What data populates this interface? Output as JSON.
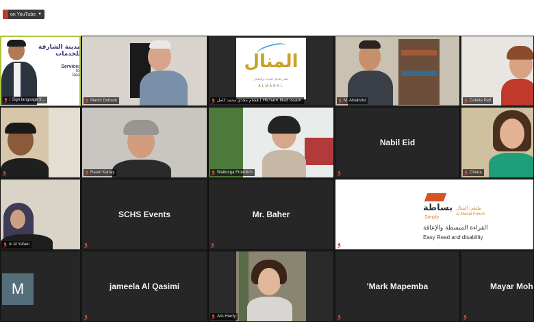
{
  "youtube_chip": {
    "label": "on YouTube"
  },
  "tiles": [
    {
      "key": "sign",
      "label": "| Sign language Ir...",
      "sign_title_ar": "مدينة الشارقة للخدمات",
      "sign_services": "Services",
      "sign_for": "for",
      "sign_deaf": "Deaf"
    },
    {
      "key": "martin",
      "label": "Martin Dobson"
    },
    {
      "key": "manal",
      "label": "هشام مجدي محمد كامل | Hicham Mad Issam",
      "logo_ar": "المنال",
      "logo_sub": "ملتقى المنال للشباب والأطفال",
      "logo_en": "ALMANAL"
    },
    {
      "key": "alnabulsi",
      "label": "M. Alnabulsi"
    },
    {
      "key": "colette",
      "label": "Colette Pelf"
    },
    {
      "key": "person2",
      "label": ""
    },
    {
      "key": "raouf",
      "label": "Raouf Karray"
    },
    {
      "key": "walburga",
      "label": "Walburga Froehlich"
    },
    {
      "key": "nabil",
      "center": "Nabil Eid"
    },
    {
      "key": "chiara",
      "label": "Chiara"
    },
    {
      "key": "yafaei",
      "label": "m Al Yafaei"
    },
    {
      "key": "schs",
      "center": "SCHS Events"
    },
    {
      "key": "baher",
      "center": "Mr. Baher"
    },
    {
      "key": "forum",
      "forum_ar_top": "ملتقى المنال",
      "forum_en": "Al Manal Forum",
      "forum_brand_ar": "بساطة",
      "forum_brand_en": "Simply",
      "forum_line_ar": "القراءة المبسطة والإعاقة",
      "forum_line_en": "Easy Read and disability"
    },
    {
      "key": "m_avatar",
      "initial": "M"
    },
    {
      "key": "jameela",
      "center": "jameela Al Qasimi"
    },
    {
      "key": "alis",
      "label": "Alis Hardy"
    },
    {
      "key": "mark",
      "center": "'Mark Mapemba"
    },
    {
      "key": "mayar",
      "center": "Mayar Moh"
    }
  ]
}
